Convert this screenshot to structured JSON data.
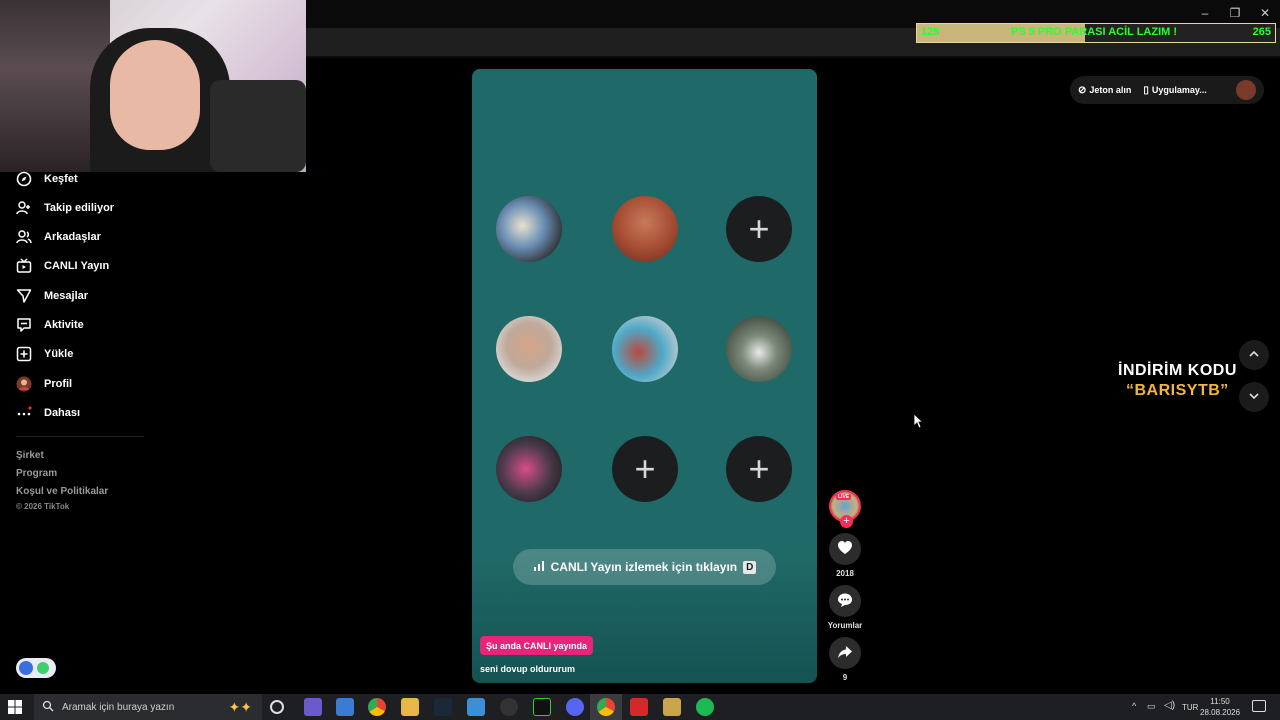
{
  "browser": {
    "window_controls": [
      "–",
      "❐",
      "✕"
    ]
  },
  "overlay_goal": {
    "current": "125",
    "text": "PS 5 PRO PARASI ACİL LAZIM !",
    "target": "265",
    "progress": 0.47
  },
  "sidebar": {
    "items": [
      {
        "label": "Keşfet",
        "icon": "compass-icon"
      },
      {
        "label": "Takip ediliyor",
        "icon": "follow-user-icon"
      },
      {
        "label": "Arkadaşlar",
        "icon": "friends-icon"
      },
      {
        "label": "CANLI Yayın",
        "icon": "live-tv-icon"
      },
      {
        "label": "Mesajlar",
        "icon": "message-icon"
      },
      {
        "label": "Aktivite",
        "icon": "activity-icon"
      },
      {
        "label": "Yükle",
        "icon": "upload-icon"
      },
      {
        "label": "Profil",
        "icon": "profile-avatar-icon"
      },
      {
        "label": "Dahası",
        "icon": "more-icon"
      }
    ],
    "footer_links": [
      "Şirket",
      "Program",
      "Koşul ve Politikalar"
    ],
    "copyright": "© 2026 TikTok"
  },
  "topbar": {
    "coins_label": "Jeton alın",
    "app_label": "Uygulamay..."
  },
  "video": {
    "watch_live_label": "CANLI Yayın izlemek için tıklayın",
    "watch_live_key": "D",
    "live_badge": "Şu anda CANLI yayında",
    "caption": "seni dovup oldururum"
  },
  "actions": {
    "live_tag": "LIVE",
    "likes": "2018",
    "comments_label": "Yorumlar",
    "shares": "9"
  },
  "promo": {
    "line1": "İNDİRİM KODU",
    "line2": "“BARISYTB”"
  },
  "taskbar": {
    "search_placeholder": "Aramak için buraya yazın",
    "language": "TUR",
    "time": "11:50",
    "date": "28.08.2026"
  }
}
